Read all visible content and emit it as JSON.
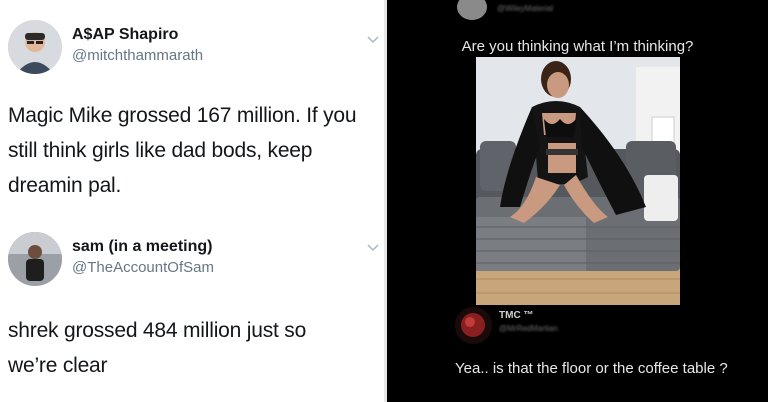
{
  "tweet1": {
    "name": "A$AP Shapiro",
    "handle": "@mitchthammarath",
    "text": "Magic Mike grossed 167 million. If you still think girls like dad bods, keep dreamin pal."
  },
  "tweet2": {
    "name": "sam (in a meeting)",
    "handle": "@TheAccountOfSam",
    "text": "shrek grossed 484 million just so we’re clear"
  },
  "right_post": {
    "caption": "Are you thinking what I’m thinking?",
    "top_handle": "@WileyMaterial",
    "photo_icon": "photo-icon"
  },
  "reply": {
    "name": "TMC ™",
    "handle": "@MrRedMartian",
    "text": "Yea.. is that the floor or the coffee table ?"
  },
  "colors": {
    "light_bg": "#ffffff",
    "dark_bg": "#000000",
    "name_text": "#14171a",
    "handle_text": "#657786",
    "dark_text": "#e8e8e8"
  }
}
